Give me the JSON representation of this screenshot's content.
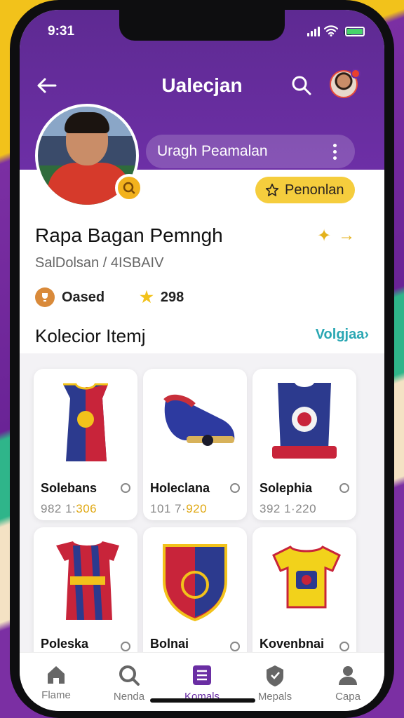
{
  "status_bar": {
    "time": "9:31"
  },
  "header": {
    "title": "Ualecjan",
    "pill_label": "Uragh Peamalan"
  },
  "profile": {
    "premium_label": "Penonlan",
    "name": "Rapa Bagan Pemngh",
    "subtitle": "SalDolsan / 4ISBAIV",
    "stat_1": "Oased",
    "stat_2": "298"
  },
  "collection": {
    "title": "Kolecior Itemj",
    "view_all": "Volgjaa›",
    "items": [
      {
        "name": "Solebans",
        "num": "982 1:",
        "val": "306",
        "icon": "jersey-icon"
      },
      {
        "name": "Holeclana",
        "num": "101 7·",
        "val": "920",
        "icon": "boot-icon"
      },
      {
        "name": "Solephia",
        "num": "392 1·220",
        "val": "",
        "icon": "crest-icon"
      },
      {
        "name": "Poleska",
        "num": "",
        "val": "",
        "icon": "jersey-icon"
      },
      {
        "name": "Bolnai",
        "num": "",
        "val": "",
        "icon": "shield-icon"
      },
      {
        "name": "Kovenbnai",
        "num": "",
        "val": "",
        "icon": "shirt-icon"
      }
    ]
  },
  "nav": [
    {
      "label": "Flame",
      "icon": "home-icon"
    },
    {
      "label": "Nenda",
      "icon": "search-icon"
    },
    {
      "label": "Komals",
      "icon": "collection-icon"
    },
    {
      "label": "Mepals",
      "icon": "badge-icon"
    },
    {
      "label": "Capa",
      "icon": "profile-icon"
    }
  ],
  "colors": {
    "primary": "#6a2ea3",
    "accent": "#f5cd3d",
    "link": "#2aa7b3"
  }
}
